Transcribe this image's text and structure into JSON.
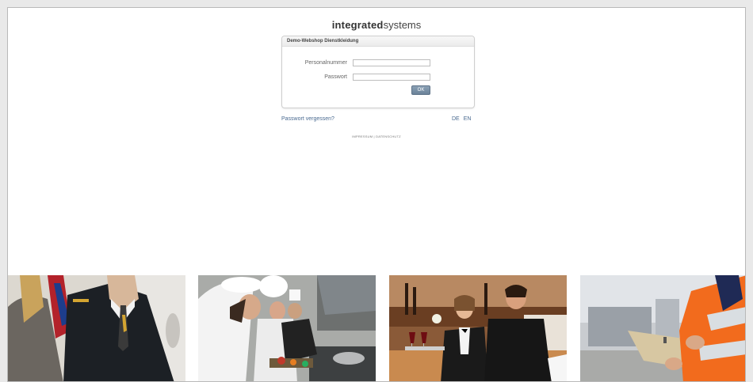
{
  "brand": {
    "bold": "integrated",
    "light": "systems"
  },
  "login": {
    "title": "Demo-Webshop Dienstkleidung",
    "personalnummer_label": "Personalnummer",
    "personalnummer_value": "",
    "passwort_label": "Passwort",
    "passwort_value": "",
    "ok_label": "OK"
  },
  "links": {
    "forgot": "Passwort vergessen?",
    "lang_de": "DE",
    "lang_en": "EN",
    "impressum": "IMPRESSUM",
    "separator": " | ",
    "datenschutz": "DATENSCHUTZ"
  },
  "photos": [
    {
      "subject": "pilot-uniform"
    },
    {
      "subject": "chefs-kitchen"
    },
    {
      "subject": "waiters-restaurant"
    },
    {
      "subject": "worker-high-vis"
    }
  ],
  "colors": {
    "link": "#4a6a90",
    "button": "#6b8299",
    "page_bg": "#ffffff"
  }
}
